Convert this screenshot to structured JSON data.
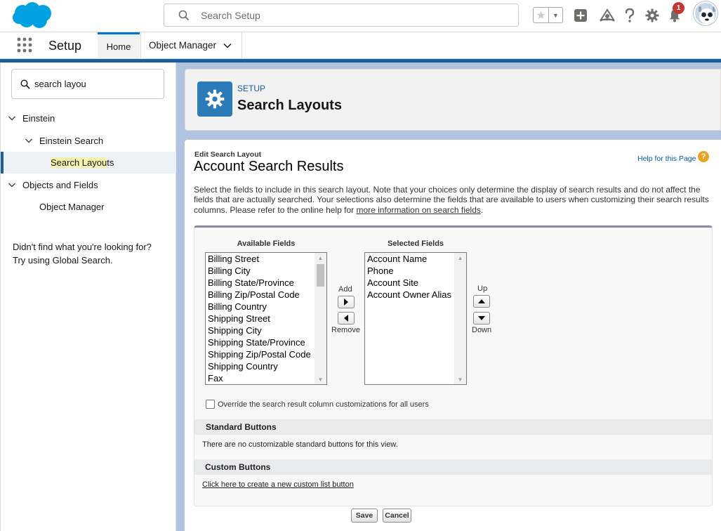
{
  "colors": {
    "brand": "#00a1e0",
    "accent": "#0176d3",
    "nav_strip": "#1b5f9e",
    "notification": "#c23934",
    "setup_icon_bg": "#2d7ab8",
    "help_icon": "#e8a325"
  },
  "header": {
    "search_placeholder": "Search Setup",
    "icons": [
      "salesforce-logo",
      "search-icon",
      "favorites-star-icon",
      "chevron-down-icon",
      "add-icon",
      "trailhead-icon",
      "help-icon",
      "gear-icon",
      "bell-icon",
      "avatar"
    ],
    "notification_count": "1"
  },
  "nav": {
    "app_name": "Setup",
    "tabs": [
      {
        "label": "Home"
      },
      {
        "label": "Object Manager"
      }
    ]
  },
  "sidebar": {
    "quickfind_value": "search layou",
    "tree": [
      {
        "label": "Einstein"
      },
      {
        "label": "Einstein Search"
      },
      {
        "label_hl": "Search Layou",
        "label_rest": "ts"
      },
      {
        "label": "Objects and Fields"
      },
      {
        "label": "Object Manager"
      }
    ],
    "not_found_line1": "Didn't find what you're looking for?",
    "not_found_line2": "Try using Global Search."
  },
  "page_header": {
    "kicker": "SETUP",
    "title": "Search Layouts"
  },
  "content": {
    "kicker": "Edit Search Layout",
    "title": "Account Search Results",
    "help_link": "Help for this Page",
    "help_icon": "?",
    "intro": "Select the fields to include in this search layout. Note that your choices only determine the display of search results and do not affect the fields that are actually searched. Your selections also determine the fields that are available to users when customizing their search results columns. Please refer to the online help for ",
    "intro_link": "more information on search fields",
    "intro_end": ".",
    "available_label": "Available Fields",
    "selected_label": "Selected Fields",
    "available_fields": [
      "Billing Street",
      "Billing City",
      "Billing State/Province",
      "Billing Zip/Postal Code",
      "Billing Country",
      "Shipping Street",
      "Shipping City",
      "Shipping State/Province",
      "Shipping Zip/Postal Code",
      "Shipping Country",
      "Fax"
    ],
    "selected_fields": [
      "Account Name",
      "Phone",
      "Account Site",
      "Account Owner Alias"
    ],
    "add_label": "Add",
    "remove_label": "Remove",
    "up_label": "Up",
    "down_label": "Down",
    "override_label": "Override the search result column customizations for all users",
    "override_checked": false,
    "standard_buttons_title": "Standard Buttons",
    "standard_buttons_text": "There are no customizable standard buttons for this view.",
    "custom_buttons_title": "Custom Buttons",
    "custom_buttons_link": "Click here to create a new custom list button",
    "save_label": "Save",
    "cancel_label": "Cancel"
  }
}
